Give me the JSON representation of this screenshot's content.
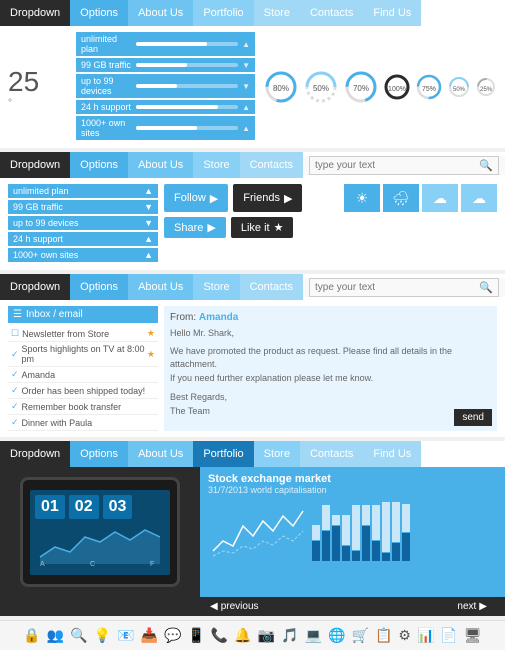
{
  "section1": {
    "nav": [
      {
        "label": "Dropdown",
        "style": "dark"
      },
      {
        "label": "Options",
        "style": "blue"
      },
      {
        "label": "About Us",
        "style": "mid"
      },
      {
        "label": "Portfolio",
        "style": "light"
      },
      {
        "label": "Store",
        "style": "lighter"
      },
      {
        "label": "Contacts",
        "style": "lighter"
      },
      {
        "label": "Find Us",
        "style": "lighter"
      }
    ],
    "temperature": "25",
    "temp_unit": "°",
    "info_rows": [
      {
        "label": "unlimited plan",
        "fill": 70
      },
      {
        "label": "99 GB traffic",
        "fill": 50
      },
      {
        "label": "up to 99 devices",
        "fill": 40
      },
      {
        "label": "24 h support",
        "fill": 80
      },
      {
        "label": "1000+ own sites",
        "fill": 60
      }
    ],
    "circles": [
      {
        "pct": 80,
        "color": "#4ab0e8"
      },
      {
        "pct": 50,
        "color": "#88d0f5"
      },
      {
        "pct": 70,
        "color": "#4ab0e8"
      },
      {
        "pct": 100,
        "color": "#2b2b2b"
      },
      {
        "pct": 75,
        "color": "#4ab0e8"
      },
      {
        "pct": 50,
        "color": "#88d0f5"
      },
      {
        "pct": 25,
        "color": "#aaa"
      }
    ]
  },
  "section2": {
    "nav": [
      {
        "label": "Dropdown",
        "style": "dark"
      },
      {
        "label": "Options",
        "style": "blue"
      },
      {
        "label": "About Us",
        "style": "mid"
      },
      {
        "label": "Store",
        "style": "light"
      },
      {
        "label": "Contacts",
        "style": "lighter"
      }
    ],
    "search_placeholder": "type your text",
    "info_rows": [
      {
        "label": "unlimited plan"
      },
      {
        "label": "99 GB traffic"
      },
      {
        "label": "up to 99 devices"
      },
      {
        "label": "24 h support"
      },
      {
        "label": "1000+ own sites"
      }
    ],
    "buttons": [
      {
        "label": "Follow",
        "icon": "▶"
      },
      {
        "label": "Friends",
        "icon": "▶"
      },
      {
        "label": "Share",
        "icon": "▶"
      },
      {
        "label": "Like it",
        "icon": "★"
      }
    ]
  },
  "section3": {
    "nav": [
      {
        "label": "Dropdown",
        "style": "dark"
      },
      {
        "label": "Options",
        "style": "blue"
      },
      {
        "label": "About Us",
        "style": "mid"
      },
      {
        "label": "Store",
        "style": "light"
      },
      {
        "label": "Contacts",
        "style": "lighter"
      }
    ],
    "search_placeholder": "type your text",
    "inbox_title": "Inbox / email",
    "inbox_items": [
      {
        "text": "Newsletter from Store",
        "star": true,
        "checked": false
      },
      {
        "text": "Sports highlights on TV at 8:00 pm",
        "star": true,
        "checked": true
      },
      {
        "text": "Amanda",
        "star": false,
        "checked": true
      },
      {
        "text": "Order has been shipped today!",
        "star": false,
        "checked": true
      },
      {
        "text": "Remember book transfer",
        "star": false,
        "checked": true
      },
      {
        "text": "Dinner with Paula",
        "star": false,
        "checked": true
      }
    ],
    "email": {
      "from": "Amanda",
      "salutation": "Hello Mr. Shark,",
      "body": "We have promoted the product as request. Please find all details in the attachment.\nIf you need further explanation please let me know.",
      "closing": "Best Regards,\nThe Team",
      "send_label": "send"
    }
  },
  "section4": {
    "nav": [
      {
        "label": "Dropdown",
        "style": "dark"
      },
      {
        "label": "Options",
        "style": "blue"
      },
      {
        "label": "About Us",
        "style": "mid"
      },
      {
        "label": "Portfolio",
        "style": "blue-active"
      },
      {
        "label": "Store",
        "style": "light"
      },
      {
        "label": "Contacts",
        "style": "lighter"
      },
      {
        "label": "Find Us",
        "style": "lighter"
      }
    ],
    "digits": [
      "01",
      "02",
      "03"
    ],
    "chart_labels": [
      "A",
      "C",
      "F"
    ],
    "stock_title": "Stock exchange market",
    "stock_sub": "31/7/2013 world capitalisation",
    "prev_label": "previous",
    "next_label": "next"
  },
  "icons": [
    "🔒",
    "👥",
    "🔍",
    "💡",
    "📧",
    "📥",
    "💬",
    "📱",
    "📞",
    "🔔",
    "📷",
    "🎵",
    "💻",
    "🌐",
    "🛒",
    "📋",
    "⚙",
    "📊",
    "📄",
    "🖥"
  ]
}
